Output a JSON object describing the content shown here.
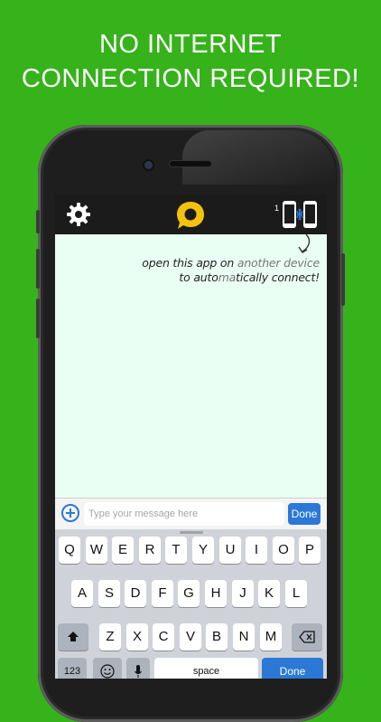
{
  "headline": {
    "line1": "NO INTERNET",
    "line2": "CONNECTION REQUIRED!"
  },
  "colors": {
    "background": "#36b21b",
    "accent_blue": "#2b78d6",
    "logo_yellow": "#f4c20d",
    "screen_bg": "#eafff3"
  },
  "navbar": {
    "left_icon": "gear-icon",
    "center_icon": "chat-bubble-logo",
    "connection_count": "1",
    "right_icon": "devices-connect-icon"
  },
  "hint": {
    "line1_a": "open this app on ",
    "line1_b": "another device",
    "line2_a": "to auto",
    "line2_b": "ma",
    "line2_c": "tically connect!"
  },
  "input": {
    "placeholder": "Type your message here",
    "value": "",
    "done_label": "Done"
  },
  "keyboard": {
    "row1": [
      "Q",
      "W",
      "E",
      "R",
      "T",
      "Y",
      "U",
      "I",
      "O",
      "P"
    ],
    "row2": [
      "A",
      "S",
      "D",
      "F",
      "G",
      "H",
      "J",
      "K",
      "L"
    ],
    "row3": [
      "Z",
      "X",
      "C",
      "V",
      "B",
      "N",
      "M"
    ],
    "numbers_label": "123",
    "space_label": "space",
    "done_label": "Done"
  }
}
